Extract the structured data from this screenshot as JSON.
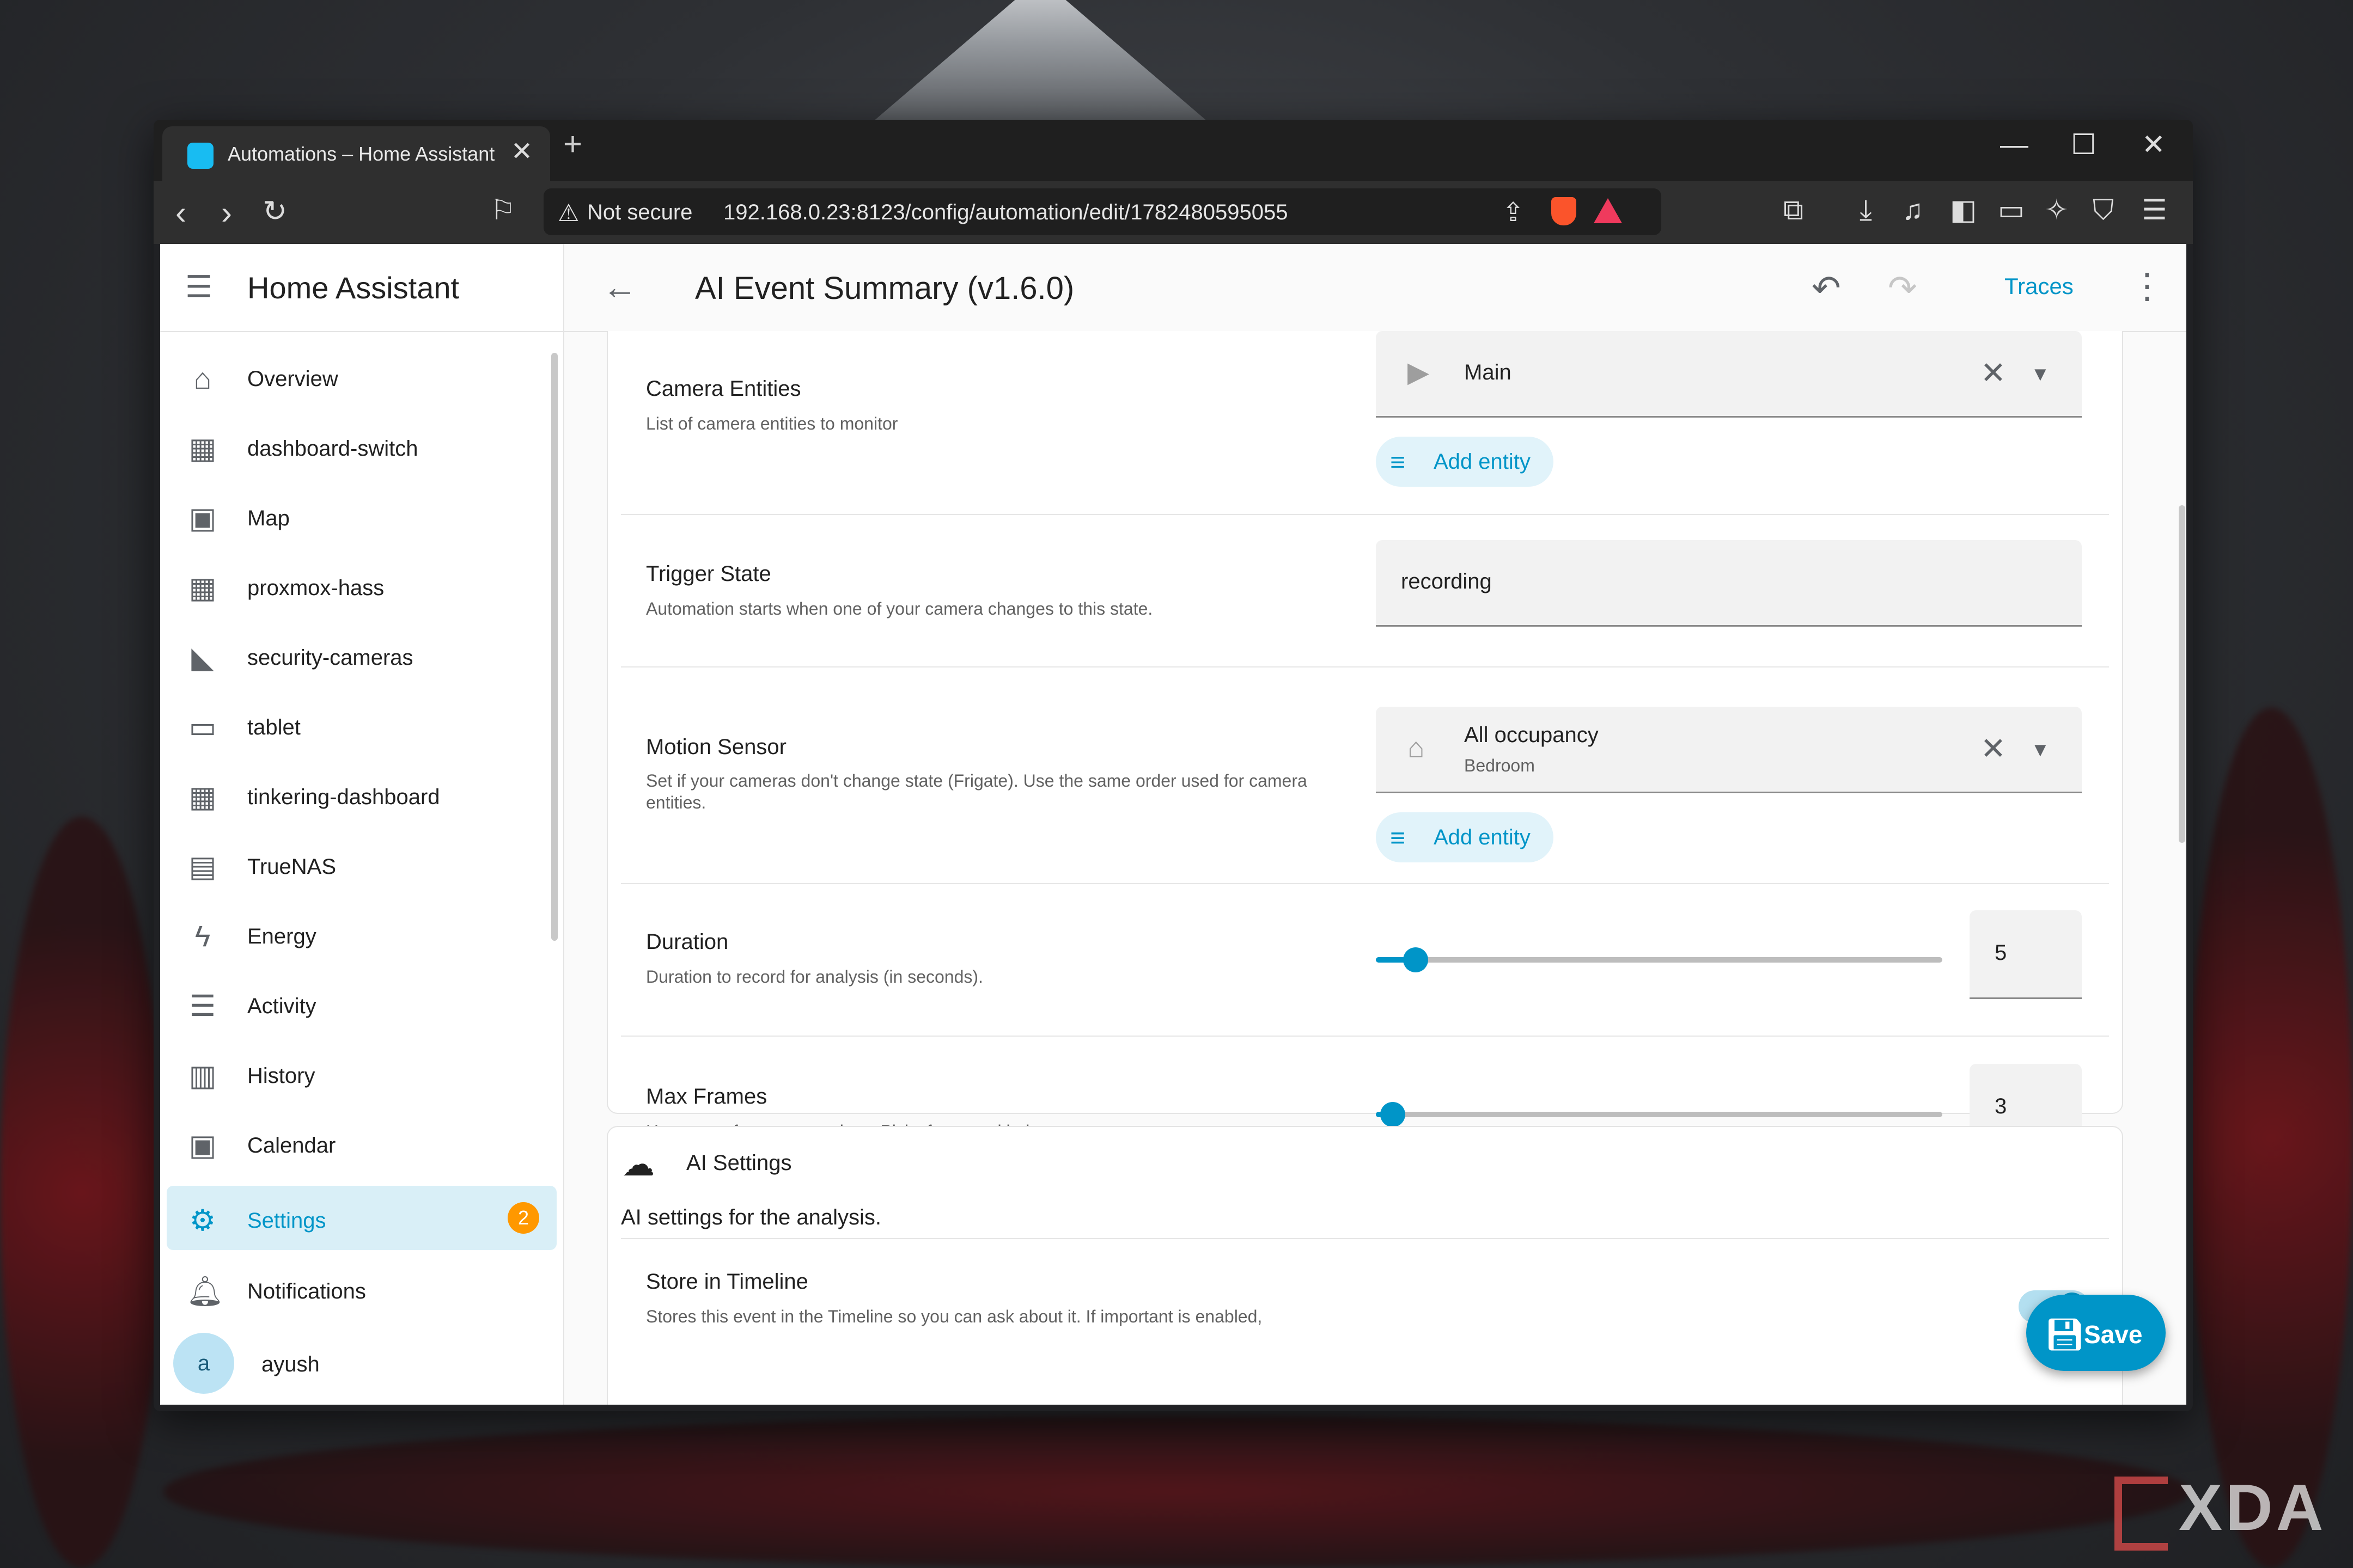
{
  "browser": {
    "tab_title": "Automations – Home Assistant",
    "url_warning": "Not secure",
    "url": "192.168.0.23:8123/config/automation/edit/1782480595055"
  },
  "app": {
    "title": "Home Assistant",
    "page_title": "AI Event Summary (v1.6.0)",
    "traces_label": "Traces",
    "save_label": "Save",
    "accent_color": "#0095c8",
    "badge_color": "#ff9800"
  },
  "sidebar": {
    "items": [
      {
        "label": "Overview",
        "icon": "home-icon"
      },
      {
        "label": "dashboard-switch",
        "icon": "dashboard-icon"
      },
      {
        "label": "Map",
        "icon": "map-icon"
      },
      {
        "label": "proxmox-hass",
        "icon": "dashboard-icon"
      },
      {
        "label": "security-cameras",
        "icon": "cctv-icon"
      },
      {
        "label": "tablet",
        "icon": "tablet-icon"
      },
      {
        "label": "tinkering-dashboard",
        "icon": "dashboard-icon"
      },
      {
        "label": "TrueNAS",
        "icon": "nas-icon"
      },
      {
        "label": "Energy",
        "icon": "lightning-icon"
      },
      {
        "label": "Activity",
        "icon": "list-icon"
      },
      {
        "label": "History",
        "icon": "chart-icon"
      },
      {
        "label": "Calendar",
        "icon": "calendar-icon"
      }
    ],
    "settings": {
      "label": "Settings",
      "badge": "2"
    },
    "notifications": {
      "label": "Notifications"
    },
    "user": {
      "initial": "a",
      "name": "ayush"
    }
  },
  "form": {
    "camera_entities": {
      "label": "Camera Entities",
      "description": "List of camera entities to monitor",
      "value": "Main",
      "add_label": "Add entity"
    },
    "trigger_state": {
      "label": "Trigger State",
      "description": "Automation starts when one of your camera changes to this state.",
      "value": "recording"
    },
    "motion_sensor": {
      "label": "Motion Sensor",
      "description": "Set if your cameras don't change state (Frigate). Use the same order used for camera entities.",
      "value": "All occupancy",
      "sub_value": "Bedroom",
      "add_label": "Add entity"
    },
    "duration": {
      "label": "Duration",
      "description": "Duration to record for analysis (in seconds).",
      "value": "5",
      "fraction": 0.07
    },
    "max_frames": {
      "label": "Max Frames",
      "description": "How many frames to analyze. Picks frames with the most movement.",
      "value": "3",
      "fraction": 0.03
    }
  },
  "ai_settings": {
    "title": "AI Settings",
    "description": "AI settings for the analysis.",
    "store_timeline": {
      "label": "Store in Timeline",
      "description": "Stores this event in the Timeline so you can ask about it. If important is enabled,",
      "enabled": true
    }
  },
  "watermark": "XDA"
}
